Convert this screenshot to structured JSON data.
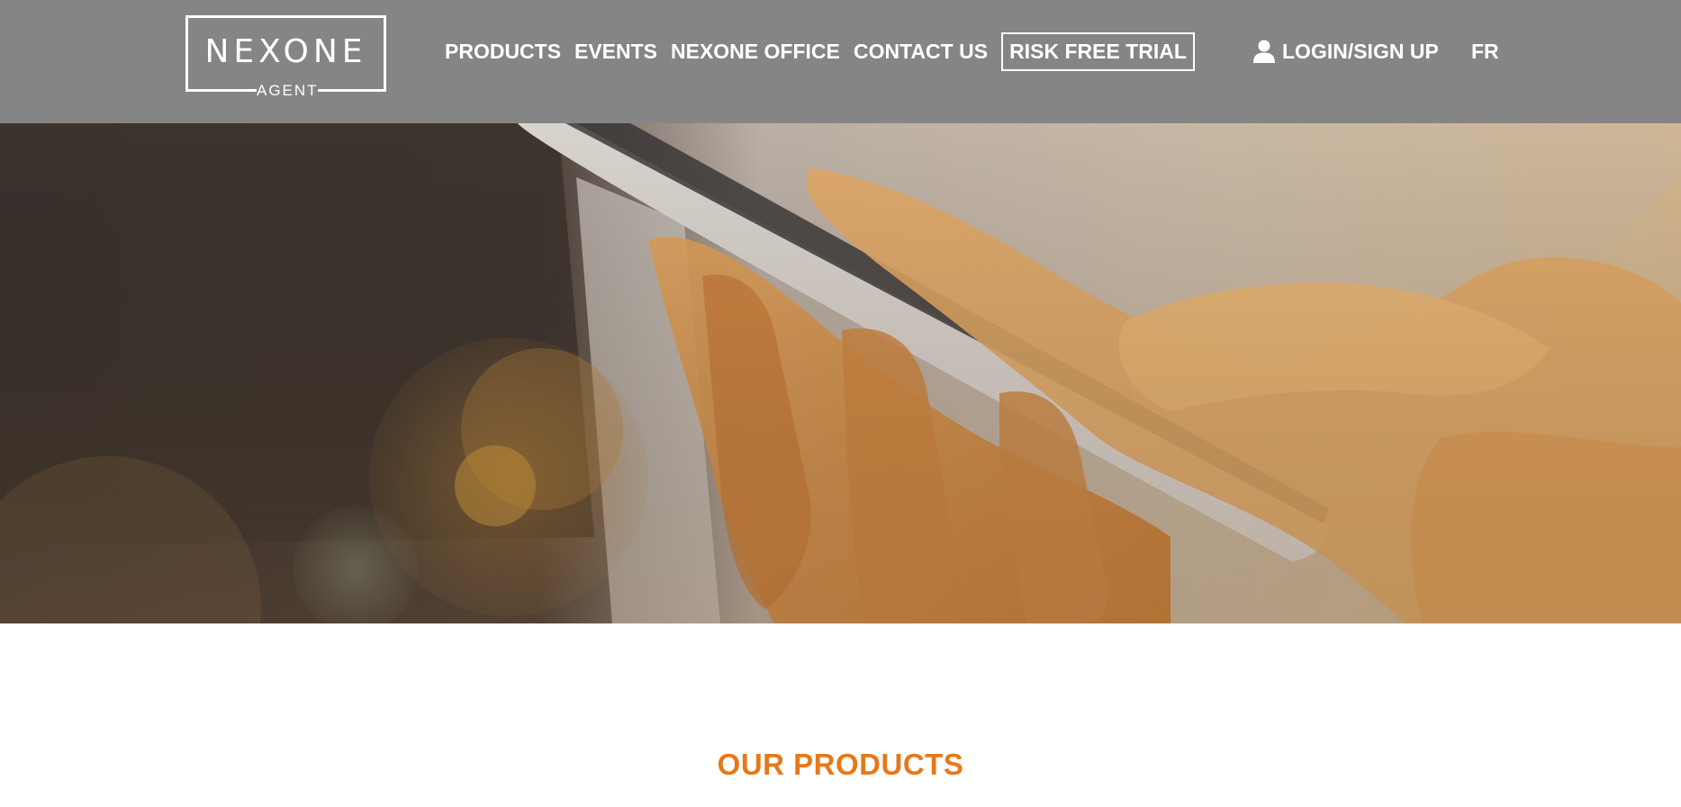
{
  "header": {
    "logo": {
      "brand": "NEXONE",
      "subtitle": "AGENT"
    },
    "nav": {
      "products": "PRODUCTS",
      "events": "EVENTS",
      "office": "NEXONE OFFICE",
      "contact": "CONTACT US",
      "trial": "RISK FREE TRIAL",
      "login": "LOGIN/SIGN UP",
      "language": "FR"
    }
  },
  "hero": {
    "scroll_icon": "chevron-down-icon"
  },
  "products_section": {
    "title": "OUR PRODUCTS"
  },
  "colors": {
    "header_bg": "#858585",
    "accent": "#e77818",
    "text_on_header": "#ffffff"
  }
}
